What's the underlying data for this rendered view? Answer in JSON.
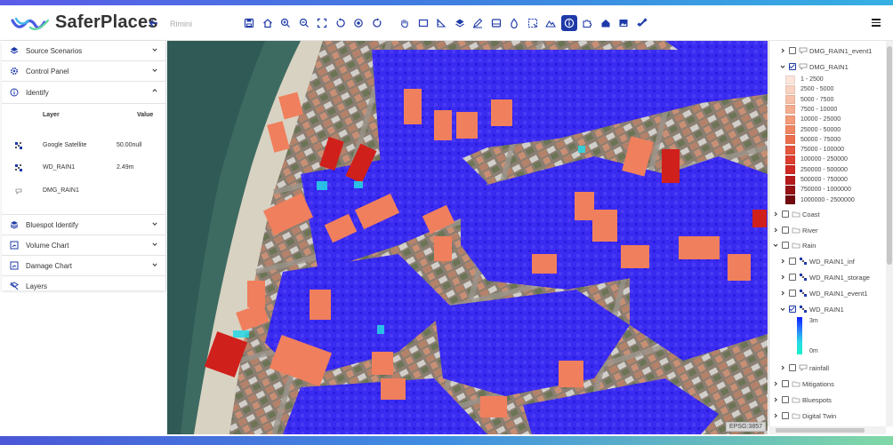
{
  "app": {
    "name": "SaferPlaces",
    "location": "Rimini"
  },
  "toolbar": {
    "icons": [
      "save-icon",
      "home-icon",
      "zoom-in-icon",
      "zoom-out-icon",
      "fullscreen-icon",
      "rotate-left-icon",
      "locate-icon",
      "rotate-right-icon",
      "pan-hand-icon",
      "rectangle-icon",
      "ruler-icon",
      "layers-fill-icon",
      "draw-icon",
      "barrier-icon",
      "water-drop-icon",
      "select-area-icon",
      "terrain-icon",
      "info-icon",
      "puzzle-icon",
      "house-icon",
      "image-icon",
      "satellite-icon"
    ],
    "active": "info-icon"
  },
  "sidebar": {
    "sections": [
      {
        "label": "Source Scenarios",
        "icon": "layers-icon"
      },
      {
        "label": "Control Panel",
        "icon": "settings-icon"
      },
      {
        "label": "Identify",
        "icon": "info-icon"
      }
    ],
    "identify": {
      "col_layer": "Layer",
      "col_value": "Value",
      "rows": [
        {
          "layer": "Google Satellite",
          "value": "50.00null"
        },
        {
          "layer": "WD_RAIN1",
          "value": "2.49m"
        },
        {
          "layer": "DMG_RAIN1",
          "value": ""
        }
      ]
    },
    "sections_after": [
      {
        "label": "Bluespot Identify",
        "icon": "bluespot-icon"
      },
      {
        "label": "Volume Chart",
        "icon": "chart-icon"
      },
      {
        "label": "Damage Chart",
        "icon": "chart-icon"
      },
      {
        "label": "Layers",
        "icon": "layers-off-icon"
      }
    ]
  },
  "map": {
    "crs": "EPSG:3857"
  },
  "layer_tree": {
    "dmg_event1": "DMG_RAIN1_event1",
    "dmg": "DMG_RAIN1",
    "dmg_legend": [
      {
        "label": "1 - 2500",
        "color": "#fbe4da"
      },
      {
        "label": "2500 - 5000",
        "color": "#f9d2c1"
      },
      {
        "label": "5000 - 7500",
        "color": "#f7c0a8"
      },
      {
        "label": "7500 - 10000",
        "color": "#f5ad90"
      },
      {
        "label": "10000 - 25000",
        "color": "#f39a78"
      },
      {
        "label": "25000 - 50000",
        "color": "#f08661"
      },
      {
        "label": "50000 - 75000",
        "color": "#ec6f4d"
      },
      {
        "label": "75000 - 100000",
        "color": "#e5563c"
      },
      {
        "label": "100000 - 250000",
        "color": "#dc3e2f"
      },
      {
        "label": "250000 - 500000",
        "color": "#cf2a25"
      },
      {
        "label": "500000 - 750000",
        "color": "#b51b1c"
      },
      {
        "label": "750000 - 1000000",
        "color": "#941215"
      },
      {
        "label": "1000000 - 2500000",
        "color": "#720b0f"
      }
    ],
    "coast": "Coast",
    "river": "River",
    "rain": "Rain",
    "wd_inf": "WD_RAIN1_inf",
    "wd_storage": "WD_RAIN1_storage",
    "wd_event1": "WD_RAIN1_event1",
    "wd": "WD_RAIN1",
    "wd_max": "3m",
    "wd_min": "0m",
    "rainfall": "rainfall",
    "mitigations": "Mitigations",
    "bluespots": "Bluespots",
    "digital_twin": "Digital Twin"
  }
}
